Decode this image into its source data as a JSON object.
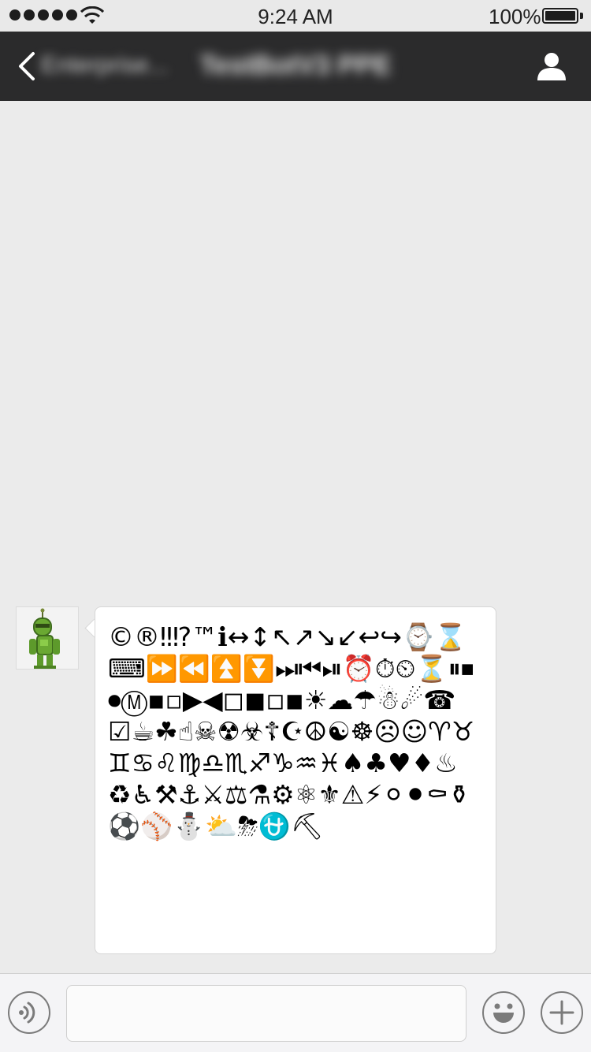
{
  "status_bar": {
    "time": "9:24 AM",
    "battery_percent": "100%",
    "signal_dots": 5,
    "icons": [
      "signal-dots-icon",
      "wifi-icon",
      "battery-icon"
    ]
  },
  "nav": {
    "back_label": "Enterprise...",
    "title": "TestBotV3 PPE",
    "icons": [
      "back-chevron-icon",
      "profile-icon"
    ]
  },
  "conversation": {
    "messages": [
      {
        "sender": "bot",
        "avatar_icon": "robot-avatar-icon",
        "text": "©®‼⁉™ℹ↔↕↖↗↘↙↩↪⌚⌛⌨⏩⏪⏫⏬⏭⏮⏯⏰⏱⏲⏳⏸⏹⏺Ⓜ▪▫▶◀◻◼◽◾☀☁☂☃☄☎☑☕☘☝☠☢☣☦☪☮☯☸☹☺♈♉♊♋♌♍♎♏♐♑♒♓♠♣♥♦♨♻♿⚒⚓⚔⚖⚗⚙⚛⚜⚠⚡⚪⚫⚰⚱⚽⚾⛄⛅⛈⛎⛏"
      }
    ]
  },
  "input_bar": {
    "placeholder": "",
    "value": "",
    "icons": [
      "voice-icon",
      "emoji-icon",
      "plus-icon"
    ]
  }
}
